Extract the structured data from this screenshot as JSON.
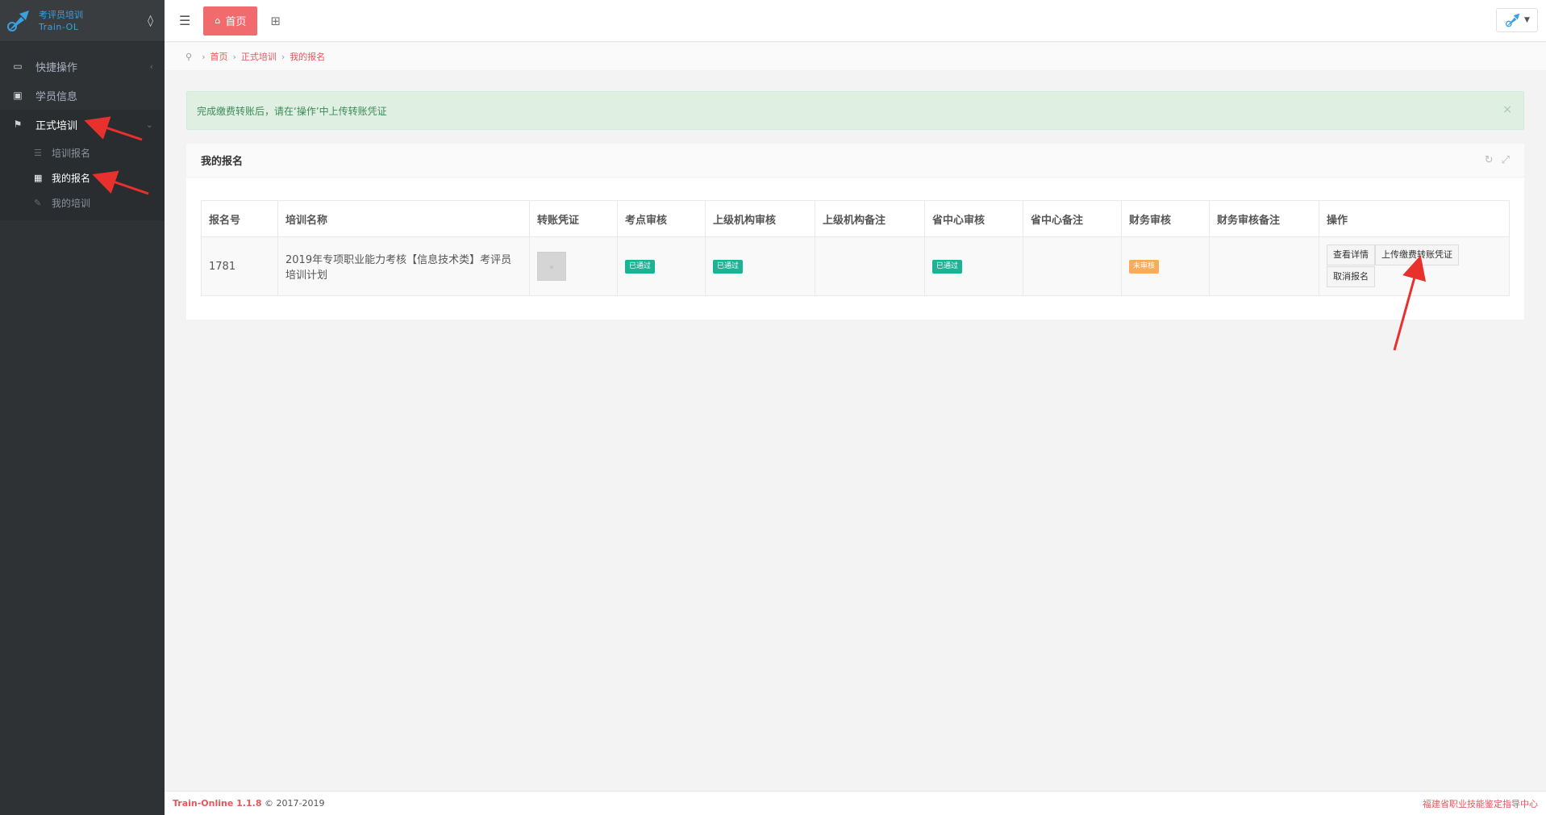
{
  "brand": {
    "line1": "考评员培训",
    "line2": "Train-OL"
  },
  "sidebar": {
    "items": [
      {
        "label": "快捷操作",
        "icon": "folder-open-icon"
      },
      {
        "label": "学员信息",
        "icon": "id-card-icon"
      },
      {
        "label": "正式培训",
        "icon": "flag-icon"
      }
    ],
    "subitems": [
      {
        "label": "培训报名",
        "icon": "list-icon"
      },
      {
        "label": "我的报名",
        "icon": "grid-icon"
      },
      {
        "label": "我的培训",
        "icon": "book-icon"
      }
    ]
  },
  "topbar": {
    "home_label": "首页"
  },
  "breadcrumb": {
    "items": [
      "首页",
      "正式培训",
      "我的报名"
    ]
  },
  "alert": {
    "text": "完成缴费转账后，请在‘操作’中上传转账凭证",
    "close": "×"
  },
  "panel": {
    "title": "我的报名"
  },
  "table": {
    "headers": [
      "报名号",
      "培训名称",
      "转账凭证",
      "考点审核",
      "上级机构审核",
      "上级机构备注",
      "省中心审核",
      "省中心备注",
      "财务审核",
      "财务审核备注",
      "操作"
    ],
    "rows": [
      {
        "id": "1781",
        "name": "2019年专项职业能力考核【信息技术类】考评员培训计划",
        "site_review": "已通过",
        "org_review": "已通过",
        "org_note": "",
        "center_review": "已通过",
        "center_note": "",
        "finance_review": "未审核",
        "finance_note": "",
        "ops": [
          "查看详情",
          "上传缴费转账凭证",
          "取消报名"
        ]
      }
    ]
  },
  "footer": {
    "brand": "Train-Online 1.1.8",
    "copyright": "© 2017-2019",
    "org": "福建省职业技能鉴定指导中心"
  },
  "colors": {
    "accent": "#f16a6e",
    "success": "#1ab394",
    "warning": "#f8ac59",
    "sidebar": "#2f3234"
  }
}
